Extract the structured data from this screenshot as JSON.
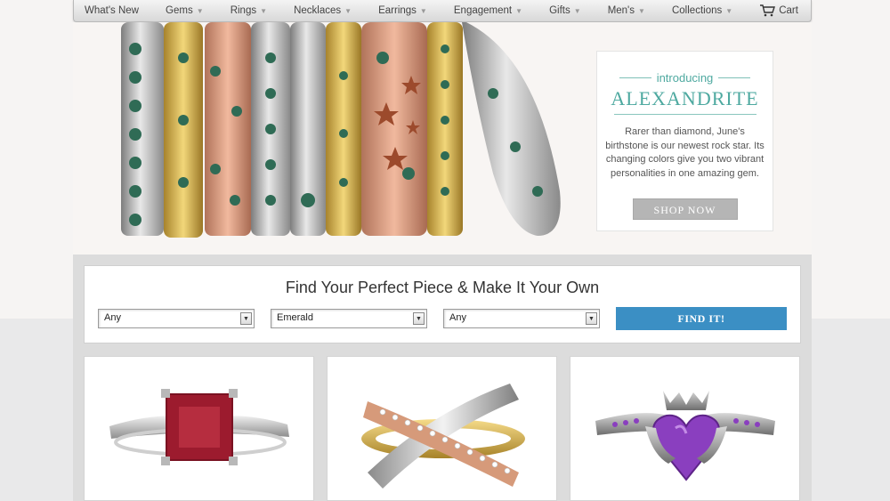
{
  "nav": {
    "items": [
      {
        "label": "What's New",
        "has_caret": false
      },
      {
        "label": "Gems",
        "has_caret": true
      },
      {
        "label": "Rings",
        "has_caret": true
      },
      {
        "label": "Necklaces",
        "has_caret": true
      },
      {
        "label": "Earrings",
        "has_caret": true
      },
      {
        "label": "Engagement",
        "has_caret": true
      },
      {
        "label": "Gifts",
        "has_caret": true
      },
      {
        "label": "Men's",
        "has_caret": true
      },
      {
        "label": "Collections",
        "has_caret": true
      }
    ],
    "cart_label": "Cart",
    "cart_icon": "cart-icon",
    "caret_glyph": "▼"
  },
  "promo": {
    "intro": "introducing",
    "title": "ALEXANDRITE",
    "text": "Rarer than diamond, June's birthstone is our newest rock star. Its changing colors give you two vibrant personalities in one amazing gem.",
    "button": "SHOP NOW",
    "accent_color": "#4ea9a0"
  },
  "finder": {
    "title": "Find Your Perfect Piece & Make It Your Own",
    "selects": [
      {
        "value": "Any"
      },
      {
        "value": "Emerald"
      },
      {
        "value": "Any"
      }
    ],
    "button": "FIND IT!",
    "button_color": "#3b8fc4"
  },
  "products": [
    {
      "name": "ruby-princess-ring-image",
      "stone_color": "#9c1b2e"
    },
    {
      "name": "crossover-rings-image",
      "stone_color": "#ffffff"
    },
    {
      "name": "amethyst-claddagh-ring-image",
      "stone_color": "#8a3fbf"
    }
  ]
}
